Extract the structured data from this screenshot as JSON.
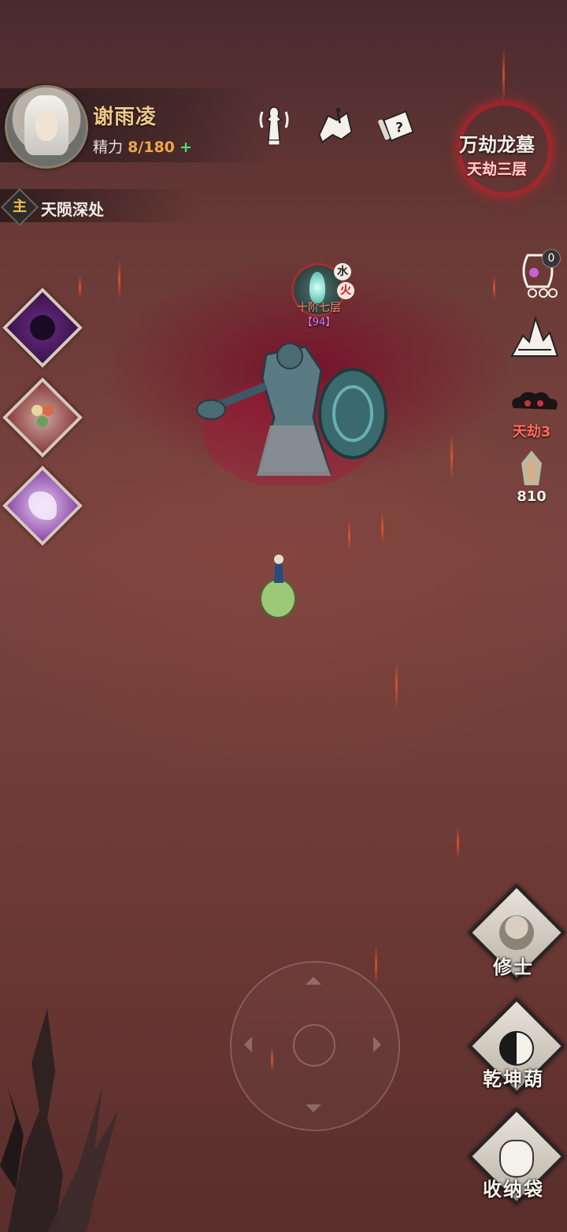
{
  "player": {
    "name": "谢雨凌",
    "energy_label": "精力",
    "energy_value": "8/180",
    "energy_add": "+"
  },
  "quest": {
    "badge": "主",
    "text": "天陨深处"
  },
  "top_icons": [
    "bell-tower-icon",
    "map-scroll-icon",
    "quest-scroll-icon"
  ],
  "location": {
    "name": "万劫龙墓",
    "floor": "天劫三层"
  },
  "left_skills": [
    "shadow-demon-icon",
    "dango-icon",
    "fox-spirit-icon"
  ],
  "right_panel": {
    "pet_count": "0",
    "tribulation_label": "天劫3",
    "crystal_count": "810"
  },
  "boss": {
    "element1": "水",
    "element2": "火",
    "level": "十阶七层",
    "power": "【94】"
  },
  "bottom_buttons": {
    "cultivator": "修士",
    "gourd": "乾坤葫",
    "bag": "收纳袋"
  },
  "colors": {
    "accent_gold": "#f0c98a",
    "energy_orange": "#f0a64a",
    "plus_green": "#4fe070",
    "tribulation_red": "#ff6a5a"
  }
}
